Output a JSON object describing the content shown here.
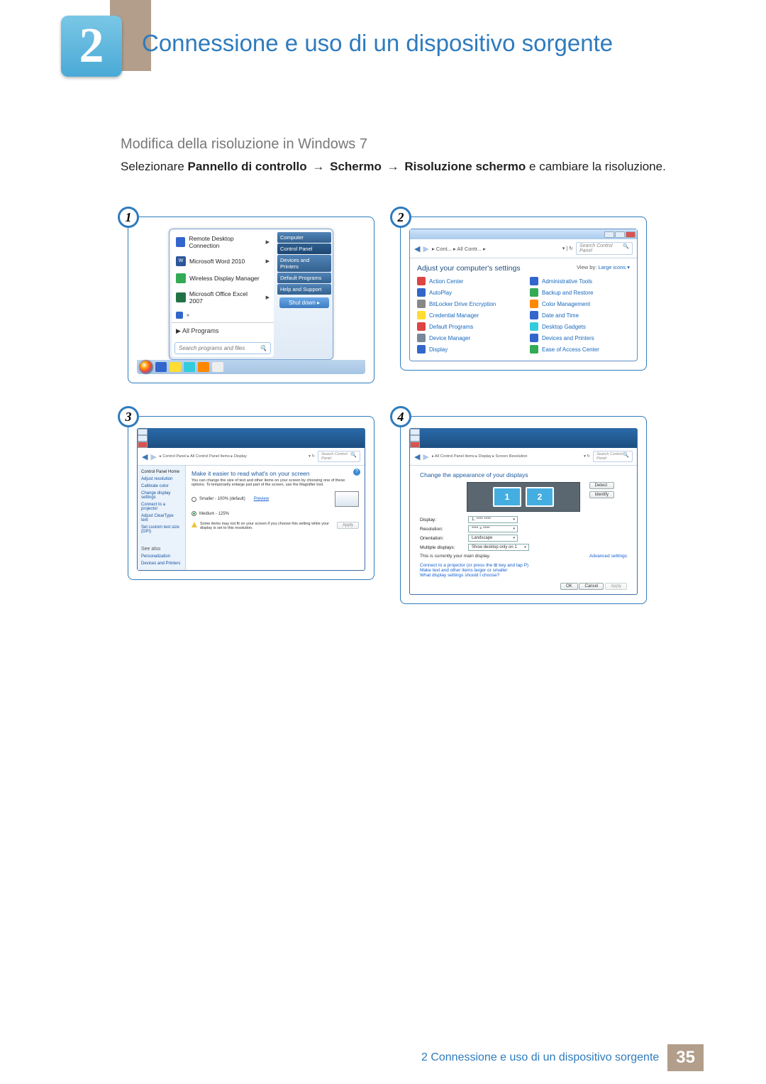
{
  "chapter_number": "2",
  "chapter_title": "Connessione e uso di un dispositivo sorgente",
  "section_heading": "Modifica della risoluzione in Windows 7",
  "instruction": {
    "pre": "Selezionare ",
    "b1": "Pannello di controllo",
    "arrow": "→",
    "b2": "Schermo",
    "b3": "Risoluzione schermo",
    "post": " e cambiare la risoluzione."
  },
  "steps": {
    "s1": "1",
    "s2": "2",
    "s3": "3",
    "s4": "4"
  },
  "start_menu": {
    "items": [
      "Remote Desktop Connection",
      "Microsoft Word 2010",
      "Wireless Display Manager",
      "Microsoft Office Excel 2007"
    ],
    "all_programs": "All Programs",
    "search_placeholder": "Search programs and files",
    "right": [
      "Computer",
      "Control Panel",
      "Devices and Printers",
      "Default Programs",
      "Help and Support"
    ],
    "shutdown": "Shut down"
  },
  "control_panel": {
    "breadcrumb": "▸ Cont... ▸ All Contr... ▸",
    "search_placeholder": "Search Control Panel",
    "heading": "Adjust your computer's settings",
    "viewby_label": "View by:",
    "viewby_value": "Large icons ▾",
    "items_left": [
      "Action Center",
      "AutoPlay",
      "BitLocker Drive Encryption",
      "Credential Manager",
      "Default Programs",
      "Device Manager",
      "Display"
    ],
    "items_right": [
      "Administrative Tools",
      "Backup and Restore",
      "Color Management",
      "Date and Time",
      "Desktop Gadgets",
      "Devices and Printers",
      "Ease of Access Center"
    ]
  },
  "display_win": {
    "breadcrumb": "▸ Control Panel ▸ All Control Panel Items ▸ Display",
    "side": [
      "Control Panel Home",
      "Adjust resolution",
      "Calibrate color",
      "Change display settings",
      "Connect to a projector",
      "Adjust ClearType text",
      "Set custom text size (DPI)"
    ],
    "see_also": "See also",
    "see_items": [
      "Personalization",
      "Devices and Printers"
    ],
    "heading": "Make it easier to read what's on your screen",
    "text": "You can change the size of text and other items on your screen by choosing one of these options. To temporarily enlarge just part of the screen, use the Magnifier tool.",
    "opt1": "Smaller - 100% (default)",
    "opt1b": "Preview",
    "opt2": "Medium - 125%",
    "warn": "Some items may not fit on your screen if you choose this setting while your display is set to this resolution.",
    "apply": "Apply"
  },
  "resolution_win": {
    "breadcrumb": "▸ All Control Panel Items ▸ Display ▸ Screen Resolution",
    "heading": "Change the appearance of your displays",
    "mon1": "1",
    "mon2": "2",
    "detect": "Detect",
    "identify": "Identify",
    "rows": {
      "display_l": "Display:",
      "display_v": "1. **** ****",
      "res_l": "Resolution:",
      "res_v": "**** × ****",
      "ori_l": "Orientation:",
      "ori_v": "Landscape",
      "multi_l": "Multiple displays:",
      "multi_v": "Show desktop only on 1"
    },
    "main_display": "This is currently your main display.",
    "advanced": "Advanced settings",
    "connect": "Connect to a projector (or press the ⊞ key and tap P)",
    "larger": "Make text and other items larger or smaller",
    "what": "What display settings should I choose?",
    "ok": "OK",
    "cancel": "Cancel",
    "apply": "Apply"
  },
  "footer": {
    "text": "2 Connessione e uso di un dispositivo sorgente",
    "page": "35"
  }
}
